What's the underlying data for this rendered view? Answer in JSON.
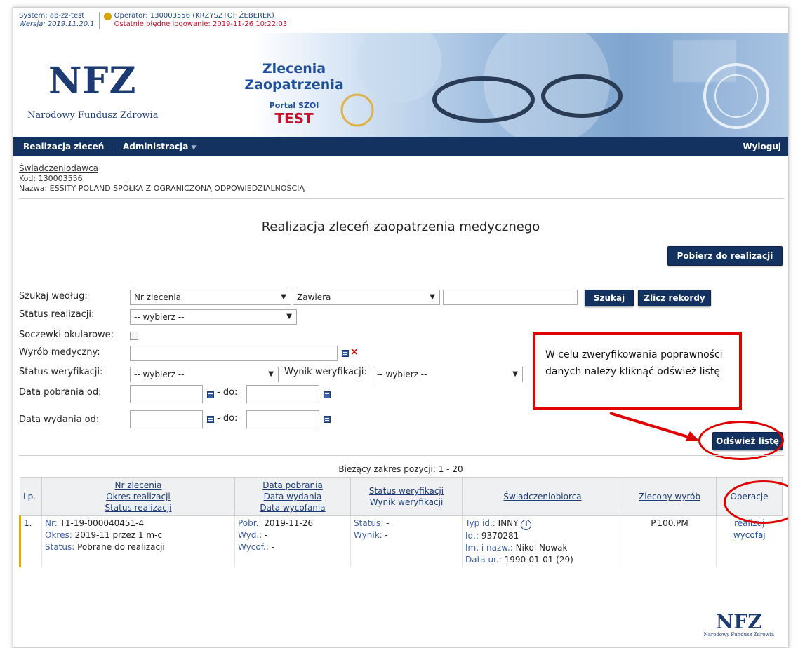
{
  "header": {
    "system": "System: ap-zz-test",
    "version": "Wersja: 2019.11.20.1",
    "operator": "Operator: 130003556 (KRZYSZTOF ŻEBEREK)",
    "last_login": "Ostatnie błędne logowanie: 2019-11-26 10:22:03",
    "logo": "NFZ",
    "logo_sub": "Narodowy Fundusz Zdrowia",
    "app_title_1": "Zlecenia",
    "app_title_2": "Zaopatrzenia",
    "portal": "Portal SZOI",
    "env": "TEST"
  },
  "nav": {
    "realizacja": "Realizacja zleceń",
    "administracja": "Administracja",
    "wyloguj": "Wyloguj"
  },
  "provider": {
    "link": "Świadczeniodawca",
    "code": "Kod: 130003556",
    "name": "Nazwa: ESSITY POLAND SPÓŁKA Z OGRANICZONĄ ODPOWIEDZIALNOŚCIĄ"
  },
  "page_title": "Realizacja zleceń zaopatrzenia medycznego",
  "buttons": {
    "pobierz": "Pobierz do realizacji",
    "szukaj": "Szukaj",
    "zlicz": "Zlicz rekordy",
    "odswiez": "Odśwież listę"
  },
  "filters": {
    "szukaj_label": "Szukaj według:",
    "szukaj_field": "Nr zlecenia",
    "szukaj_op": "Zawiera",
    "status_real_label": "Status realizacji:",
    "status_real_value": "-- wybierz --",
    "soczewki_label": "Soczewki okularowe:",
    "wyrob_label": "Wyrób medyczny:",
    "status_wer_label": "Status weryfikacji:",
    "status_wer_value": "-- wybierz --",
    "wynik_wer_label": "Wynik weryfikacji:",
    "wynik_wer_value": "-- wybierz --",
    "data_pobr_label": "Data pobrania od:",
    "data_wyd_label": "Data wydania od:",
    "do_label": "- do:"
  },
  "callout": "W celu zweryfikowania poprawności danych należy kliknąć odśwież listę",
  "range": "Bieżący zakres pozycji: 1 - 20",
  "table": {
    "headers": {
      "lp": "Lp.",
      "nr": "Nr zlecenia",
      "okres": "Okres realizacji",
      "status": "Status realizacji",
      "data_pobr": "Data pobrania",
      "data_wyd": "Data wydania",
      "data_wyc": "Data wycofania",
      "status_wer": "Status weryfikacji",
      "wynik_wer": "Wynik weryfikacji",
      "swiadczeniobiorca": "Świadczeniobiorca",
      "wyrob": "Zlecony wyrób",
      "operacje": "Operacje"
    },
    "row": {
      "lp": "1.",
      "nr_lbl": "Nr:",
      "nr": "T1-19-000040451-4",
      "okres_lbl": "Okres:",
      "okres": "2019-11 przez 1 m-c",
      "status_lbl": "Status:",
      "status": "Pobrane do realizacji",
      "pobr_lbl": "Pobr.:",
      "pobr": "2019-11-26",
      "wyd_lbl": "Wyd.:",
      "wyd": "-",
      "wyc_lbl": "Wycof.:",
      "wyc": "-",
      "swer_lbl": "Status:",
      "swer": "-",
      "wwer_lbl": "Wynik:",
      "wwer": "-",
      "typ_lbl": "Typ id.:",
      "typ": "INNY",
      "id_lbl": "Id.:",
      "id": "9370281",
      "imie_lbl": "Im. i nazw.:",
      "imie": "Nikol Nowak",
      "ur_lbl": "Data ur.:",
      "ur": "1990-01-01 (29)",
      "wyrob": "P.100.PM",
      "op1": "realizuj",
      "op2": "wycofaj"
    }
  },
  "footer_logo": "NFZ",
  "footer_sub": "Narodowy Fundusz Zdrowia",
  "colors": {
    "navy": "#14325f",
    "accent_red": "#e00000",
    "link_blue": "#1d4f9a"
  }
}
